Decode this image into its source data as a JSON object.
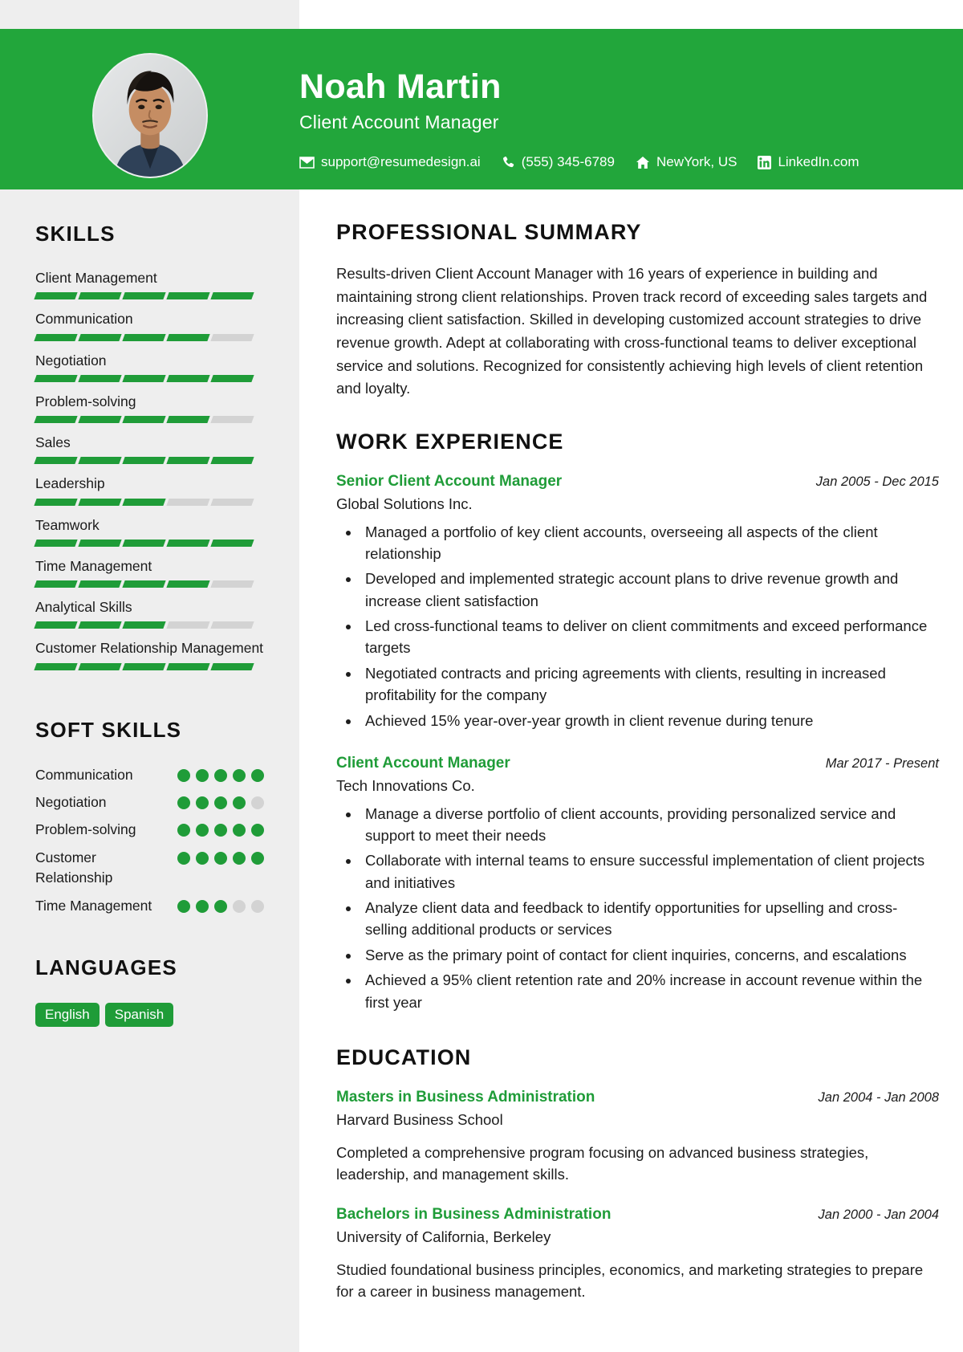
{
  "colors": {
    "accent_green": "#22A63B",
    "skill_green": "#1F9C38",
    "sidebar_bg": "#eeeeee",
    "empty_gray": "#d3d3d3"
  },
  "header": {
    "name": "Noah Martin",
    "role": "Client Account Manager",
    "contacts": [
      {
        "icon": "envelope-icon",
        "text": "support@resumedesign.ai"
      },
      {
        "icon": "phone-icon",
        "text": "(555) 345-6789"
      },
      {
        "icon": "home-icon",
        "text": "NewYork, US"
      },
      {
        "icon": "linkedin-icon",
        "text": "LinkedIn.com"
      }
    ]
  },
  "sidebar": {
    "skills_heading": "SKILLS",
    "skills_total_segments": 5,
    "skills": [
      {
        "name": "Client Management",
        "level": 5
      },
      {
        "name": "Communication",
        "level": 4
      },
      {
        "name": "Negotiation",
        "level": 5
      },
      {
        "name": "Problem-solving",
        "level": 4
      },
      {
        "name": "Sales",
        "level": 5
      },
      {
        "name": "Leadership",
        "level": 3
      },
      {
        "name": "Teamwork",
        "level": 5
      },
      {
        "name": "Time Management",
        "level": 4
      },
      {
        "name": "Analytical Skills",
        "level": 3
      },
      {
        "name": "Customer Relationship Management",
        "level": 5
      }
    ],
    "soft_skills_heading": "SOFT SKILLS",
    "soft_skills_total_dots": 5,
    "soft_skills": [
      {
        "name": "Communication",
        "level": 5
      },
      {
        "name": "Negotiation",
        "level": 4
      },
      {
        "name": "Problem-solving",
        "level": 5
      },
      {
        "name": "Customer Relationship",
        "level": 5
      },
      {
        "name": "Time Management",
        "level": 3
      }
    ],
    "languages_heading": "LANGUAGES",
    "languages": [
      "English",
      "Spanish"
    ]
  },
  "main": {
    "summary_heading": "PROFESSIONAL SUMMARY",
    "summary": "Results-driven Client Account Manager with 16 years of experience in building and maintaining strong client relationships. Proven track record of exceeding sales targets and increasing client satisfaction. Skilled in developing customized account strategies to drive revenue growth. Adept at collaborating with cross-functional teams to deliver exceptional service and solutions. Recognized for consistently achieving high levels of client retention and loyalty.",
    "experience_heading": "WORK EXPERIENCE",
    "experience": [
      {
        "title": "Senior Client Account Manager",
        "date": "Jan 2005 - Dec 2015",
        "company": "Global Solutions Inc.",
        "bullets": [
          "Managed a portfolio of key client accounts, overseeing all aspects of the client relationship",
          "Developed and implemented strategic account plans to drive revenue growth and increase client satisfaction",
          "Led cross-functional teams to deliver on client commitments and exceed performance targets",
          "Negotiated contracts and pricing agreements with clients, resulting in increased profitability for the company",
          "Achieved 15% year-over-year growth in client revenue during tenure"
        ]
      },
      {
        "title": "Client Account Manager",
        "date": "Mar 2017 - Present",
        "company": "Tech Innovations Co.",
        "bullets": [
          "Manage a diverse portfolio of client accounts, providing personalized service and support to meet their needs",
          "Collaborate with internal teams to ensure successful implementation of client projects and initiatives",
          "Analyze client data and feedback to identify opportunities for upselling and cross-selling additional products or services",
          "Serve as the primary point of contact for client inquiries, concerns, and escalations",
          "Achieved a 95% client retention rate and 20% increase in account revenue within the first year"
        ]
      }
    ],
    "education_heading": "EDUCATION",
    "education": [
      {
        "degree": "Masters in Business Administration",
        "date": "Jan 2004 - Jan 2008",
        "school": "Harvard Business School",
        "description": "Completed a comprehensive program focusing on advanced business strategies, leadership, and management skills."
      },
      {
        "degree": "Bachelors in Business Administration",
        "date": "Jan 2000 - Jan 2004",
        "school": "University of California, Berkeley",
        "description": "Studied foundational business principles, economics, and marketing strategies to prepare for a career in business management."
      }
    ]
  }
}
